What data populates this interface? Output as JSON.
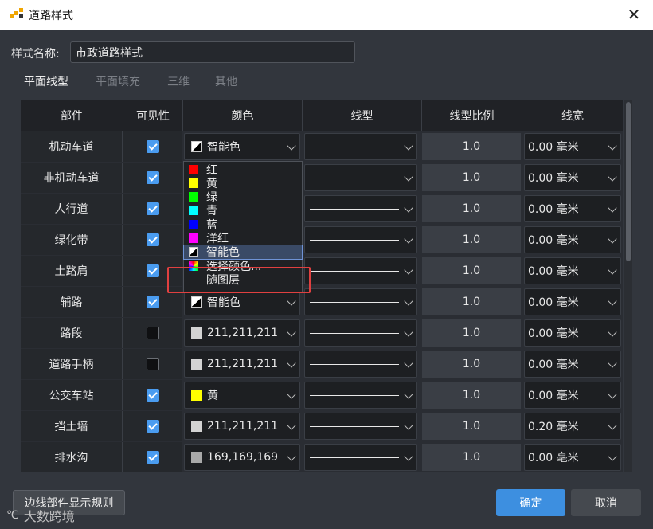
{
  "window": {
    "title": "道路样式",
    "close_glyph": "✕",
    "logo_icon": "app-logo-icon"
  },
  "style_name": {
    "label": "样式名称:",
    "value": "市政道路样式"
  },
  "tabs": [
    {
      "label": "平面线型",
      "active": true
    },
    {
      "label": "平面填充",
      "active": false
    },
    {
      "label": "三维",
      "active": false
    },
    {
      "label": "其他",
      "active": false
    }
  ],
  "table": {
    "headers": [
      "部件",
      "可见性",
      "颜色",
      "线型",
      "线型比例",
      "线宽"
    ],
    "rows": [
      {
        "name": "机动车道",
        "visible": true,
        "color": "智能色",
        "color_swatch": "smart",
        "scale": "1.0",
        "width": "0.00 毫米"
      },
      {
        "name": "非机动车道",
        "visible": true,
        "color": "",
        "color_swatch": "none",
        "scale": "1.0",
        "width": "0.00 毫米"
      },
      {
        "name": "人行道",
        "visible": true,
        "color": "",
        "color_swatch": "none",
        "scale": "1.0",
        "width": "0.00 毫米"
      },
      {
        "name": "绿化带",
        "visible": true,
        "color": "",
        "color_swatch": "none",
        "scale": "1.0",
        "width": "0.00 毫米"
      },
      {
        "name": "土路肩",
        "visible": true,
        "color": "",
        "color_swatch": "none",
        "scale": "1.0",
        "width": "0.00 毫米"
      },
      {
        "name": "辅路",
        "visible": true,
        "color": "智能色",
        "color_swatch": "smart",
        "scale": "1.0",
        "width": "0.00 毫米"
      },
      {
        "name": "路段",
        "visible": false,
        "color": "211,211,211",
        "color_swatch": "#d3d3d3",
        "scale": "1.0",
        "width": "0.00 毫米"
      },
      {
        "name": "道路手柄",
        "visible": false,
        "color": "211,211,211",
        "color_swatch": "#d3d3d3",
        "scale": "1.0",
        "width": "0.00 毫米"
      },
      {
        "name": "公交车站",
        "visible": true,
        "color": "黄",
        "color_swatch": "#ffff00",
        "scale": "1.0",
        "width": "0.00 毫米"
      },
      {
        "name": "挡土墙",
        "visible": true,
        "color": "211,211,211",
        "color_swatch": "#d3d3d3",
        "scale": "1.0",
        "width": "0.20 毫米"
      },
      {
        "name": "排水沟",
        "visible": true,
        "color": "169,169,169",
        "color_swatch": "#a9a9a9",
        "scale": "1.0",
        "width": "0.00 毫米"
      }
    ]
  },
  "color_dropdown_popup": {
    "items": [
      {
        "label": "红",
        "swatch": "#ff0000",
        "selected": false
      },
      {
        "label": "黄",
        "swatch": "#ffff00",
        "selected": false
      },
      {
        "label": "绿",
        "swatch": "#00ff00",
        "selected": false
      },
      {
        "label": "青",
        "swatch": "#00ffff",
        "selected": false
      },
      {
        "label": "蓝",
        "swatch": "#0000ff",
        "selected": false
      },
      {
        "label": "洋红",
        "swatch": "#ff00ff",
        "selected": false
      },
      {
        "label": "智能色",
        "swatch": "smart",
        "selected": true
      },
      {
        "label": "选择颜色...",
        "swatch": "rainbow",
        "selected": false
      },
      {
        "label": "随图层",
        "swatch": "none",
        "selected": false
      }
    ]
  },
  "footer": {
    "rule_button": "边线部件显示规则",
    "ok_button": "确定",
    "cancel_button": "取消"
  },
  "watermark": {
    "mark": "℃",
    "text": "大数跨境"
  },
  "colors": {
    "accent": "#3d8fe0",
    "checkbox_on": "#4a9cf0",
    "highlight_box": "#e04040",
    "dialog_bg": "#32363d"
  }
}
